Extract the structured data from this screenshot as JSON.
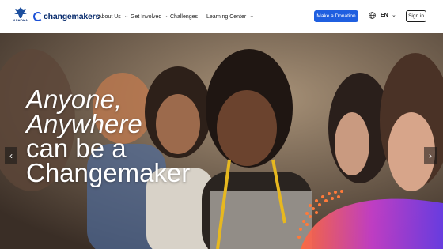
{
  "header": {
    "ashoka_logo_text": "ASHOKA",
    "brand_name": "changemakers",
    "nav": [
      {
        "label": "About Us",
        "has_dropdown": true
      },
      {
        "label": "Get Involved",
        "has_dropdown": true
      },
      {
        "label": "Challenges",
        "has_dropdown": false
      },
      {
        "label": "Learning Center",
        "has_dropdown": true
      }
    ],
    "donate_label": "Make a Donation",
    "language": "EN",
    "signin_label": "Sign in",
    "icons": {
      "globe": "globe-icon",
      "chevron": "chevron-down-icon"
    },
    "accent_color": "#1f5fe0"
  },
  "hero": {
    "title_lines": [
      "Anyone,",
      "Anywhere",
      "can be a",
      "Changemaker"
    ],
    "prev_icon": "chevron-left-icon",
    "next_icon": "chevron-right-icon",
    "prev_glyph": "‹",
    "next_glyph": "›"
  }
}
